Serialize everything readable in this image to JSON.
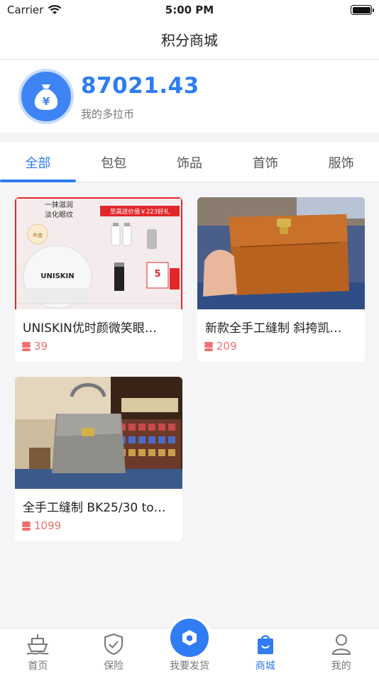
{
  "status_bar": {
    "carrier": "Carrier",
    "time": "5:00 PM"
  },
  "nav": {
    "title": "积分商城"
  },
  "wallet": {
    "amount": "87021.43",
    "label": "我的多拉币",
    "icon": "money-bag-icon"
  },
  "tabs": [
    {
      "label": "全部",
      "active": true
    },
    {
      "label": "包包"
    },
    {
      "label": "饰品"
    },
    {
      "label": "首饰"
    },
    {
      "label": "服饰"
    }
  ],
  "products": [
    {
      "title": "UNISKIN优时颜微笑眼…",
      "price": "39",
      "image": "skincare-product-image"
    },
    {
      "title": "新款全手工缝制 斜挎凯…",
      "price": "209",
      "image": "brown-leather-bag-image"
    },
    {
      "title": "全手工缝制 BK25/30 to…",
      "price": "1099",
      "image": "grey-handbag-image"
    }
  ],
  "product_image_text": {
    "banner_top": "一抹滋润 淡化眼纹",
    "banner_price": "至高送价值￥223好礼",
    "brand": "UNISKIN"
  },
  "tabbar": [
    {
      "label": "首页",
      "icon": "ship-icon"
    },
    {
      "label": "保险",
      "icon": "shield-check-icon"
    },
    {
      "label": "我要发货",
      "icon": "package-icon"
    },
    {
      "label": "商城",
      "icon": "shopping-bag-icon",
      "active": true
    },
    {
      "label": "我的",
      "icon": "user-icon"
    }
  ],
  "colors": {
    "accent": "#2f7cf5",
    "price": "#f07070",
    "background": "#f5f5f7"
  }
}
